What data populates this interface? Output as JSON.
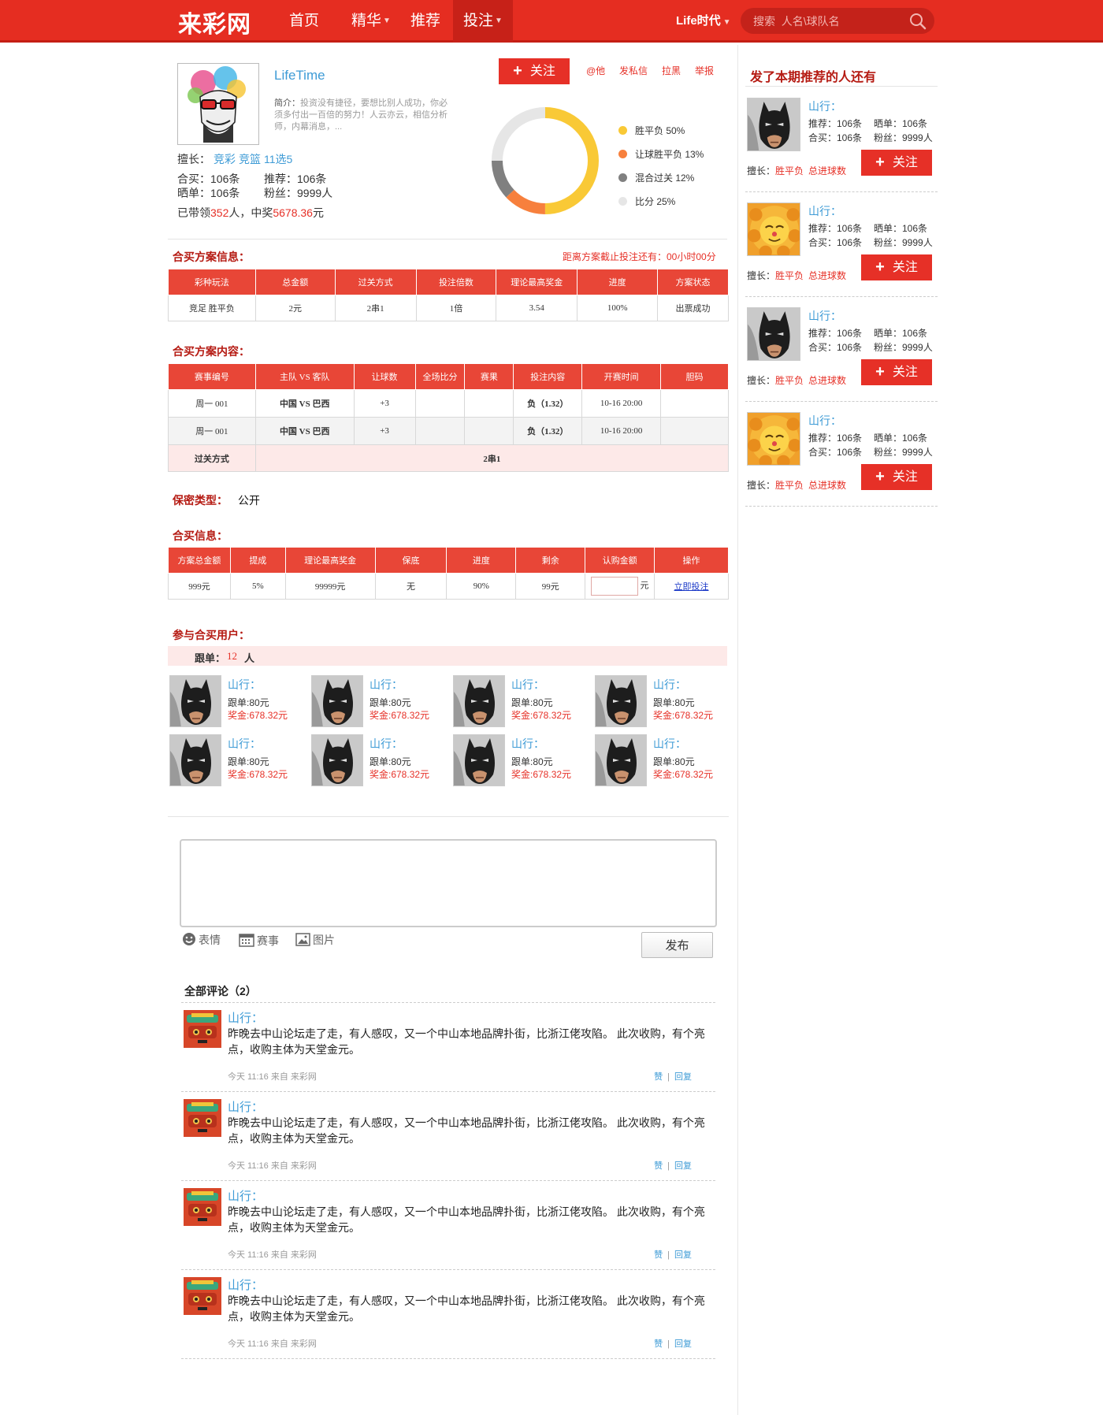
{
  "header": {
    "logo": "来彩网",
    "nav": [
      {
        "label": "首页"
      },
      {
        "label": "精华"
      },
      {
        "label": "推荐"
      },
      {
        "label": "投注"
      }
    ],
    "user": "Life时代",
    "search_placeholder": "搜索  人名\\球队名"
  },
  "profile": {
    "name": "LifeTime",
    "intro_label": "简介：",
    "intro": "投资没有捷径，要想比别人成功，你必须多付出一百倍的努力！人云亦云，相信分析师，内幕消息，...",
    "expertise_label": "擅长：",
    "expertise": [
      "竞彩",
      "竞篮",
      "11选5"
    ],
    "stats": {
      "hemai": "合买：106条",
      "tuijian": "推荐：106条",
      "shaidan": "晒单：106条",
      "fensi": "粉丝：9999人"
    },
    "led_prefix": "已带领",
    "led_count": "352",
    "led_mid": "人，中奖",
    "led_amount": "5678.36",
    "led_suffix": "元",
    "follow": "关注",
    "links": [
      "@他",
      "发私信",
      "拉黑",
      "举报"
    ]
  },
  "chart_data": {
    "type": "pie",
    "categories": [
      "胜平负",
      "让球胜平负",
      "混合过关",
      "比分"
    ],
    "values": [
      50,
      13,
      12,
      25
    ],
    "labels": [
      "胜平负  50%",
      "让球胜平负  13%",
      "混合过关  12%",
      "比分  25%"
    ],
    "colors": [
      "#f9c936",
      "#f7803d",
      "#808080",
      "#e6e6e6"
    ]
  },
  "plan_info": {
    "title": "合买方案信息：",
    "countdown": "距离方案截止投注还有：00小时00分",
    "headers": [
      "彩种玩法",
      "总金额",
      "过关方式",
      "投注倍数",
      "理论最高奖金",
      "进度",
      "方案状态"
    ],
    "row": [
      "竞足 胜平负",
      "2元",
      "2串1",
      "1倍",
      "3.54",
      "100%",
      "出票成功"
    ]
  },
  "plan_content": {
    "title": "合买方案内容：",
    "headers": [
      "赛事编号",
      "主队 VS 客队",
      "让球数",
      "全场比分",
      "赛果",
      "投注内容",
      "开赛时间",
      "胆码"
    ],
    "rows": [
      [
        "周一 001",
        "中国 VS 巴西",
        "+3",
        "",
        "",
        "负（1.32）",
        "10-16 20:00",
        ""
      ],
      [
        "周一 001",
        "中国 VS 巴西",
        "+3",
        "",
        "",
        "负（1.32）",
        "10-16 20:00",
        ""
      ]
    ],
    "pass_label": "过关方式",
    "pass_value": "2串1"
  },
  "secrecy": {
    "label": "保密类型：",
    "value": "公开"
  },
  "buy_info": {
    "title": "合买信息：",
    "headers": [
      "方案总金额",
      "提成",
      "理论最高奖金",
      "保底",
      "进度",
      "剩余",
      "认购金额",
      "操作"
    ],
    "row": [
      "999元",
      "5%",
      "99999元",
      "无",
      "90%",
      "99元"
    ],
    "unit": "元",
    "action": "立即投注"
  },
  "participants": {
    "title": "参与合买用户：",
    "follow_label": "跟单：",
    "follow_count": "12",
    "follow_unit": "人",
    "items": [
      {
        "name": "山行：",
        "follow": "跟单:80元",
        "bonus": "奖金:678.32元"
      },
      {
        "name": "山行：",
        "follow": "跟单:80元",
        "bonus": "奖金:678.32元"
      },
      {
        "name": "山行：",
        "follow": "跟单:80元",
        "bonus": "奖金:678.32元"
      },
      {
        "name": "山行：",
        "follow": "跟单:80元",
        "bonus": "奖金:678.32元"
      },
      {
        "name": "山行：",
        "follow": "跟单:80元",
        "bonus": "奖金:678.32元"
      },
      {
        "name": "山行：",
        "follow": "跟单:80元",
        "bonus": "奖金:678.32元"
      },
      {
        "name": "山行：",
        "follow": "跟单:80元",
        "bonus": "奖金:678.32元"
      },
      {
        "name": "山行：",
        "follow": "跟单:80元",
        "bonus": "奖金:678.32元"
      }
    ]
  },
  "composer": {
    "tools": [
      "表情",
      "赛事",
      "图片"
    ],
    "publish": "发布"
  },
  "comments": {
    "title": "全部评论（2）",
    "items": [
      {
        "name": "山行：",
        "text": "昨晚去中山论坛走了走，有人感叹，又一个中山本地品牌扑街，比浙江佬攻陷。 此次收购，有个亮点，收购主体为天堂金元。",
        "meta": "今天 11:16    来自 来彩网",
        "like": "赞",
        "reply": "回复"
      },
      {
        "name": "山行：",
        "text": "昨晚去中山论坛走了走，有人感叹，又一个中山本地品牌扑街，比浙江佬攻陷。 此次收购，有个亮点，收购主体为天堂金元。",
        "meta": "今天 11:16    来自 来彩网",
        "like": "赞",
        "reply": "回复"
      },
      {
        "name": "山行：",
        "text": "昨晚去中山论坛走了走，有人感叹，又一个中山本地品牌扑街，比浙江佬攻陷。 此次收购，有个亮点，收购主体为天堂金元。",
        "meta": "今天 11:16    来自 来彩网",
        "like": "赞",
        "reply": "回复"
      },
      {
        "name": "山行：",
        "text": "昨晚去中山论坛走了走，有人感叹，又一个中山本地品牌扑街，比浙江佬攻陷。 此次收购，有个亮点，收购主体为天堂金元。",
        "meta": "今天 11:16    来自 来彩网",
        "like": "赞",
        "reply": "回复"
      }
    ]
  },
  "sidebar": {
    "title": "发了本期推荐的人还有",
    "expertise_label": "擅长：",
    "items": [
      {
        "name": "山行：",
        "tuijian": "推荐：106条",
        "shaidan": "晒单：106条",
        "hemai": "合买：106条",
        "fensi": "粉丝：9999人",
        "exp1": "胜平负",
        "exp2": "总进球数",
        "follow": "关注",
        "avatar": "batman"
      },
      {
        "name": "山行：",
        "tuijian": "推荐：106条",
        "shaidan": "晒单：106条",
        "hemai": "合买：106条",
        "fensi": "粉丝：9999人",
        "exp1": "胜平负",
        "exp2": "总进球数",
        "follow": "关注",
        "avatar": "lion"
      },
      {
        "name": "山行：",
        "tuijian": "推荐：106条",
        "shaidan": "晒单：106条",
        "hemai": "合买：106条",
        "fensi": "粉丝：9999人",
        "exp1": "胜平负",
        "exp2": "总进球数",
        "follow": "关注",
        "avatar": "batman"
      },
      {
        "name": "山行：",
        "tuijian": "推荐：106条",
        "shaidan": "晒单：106条",
        "hemai": "合买：106条",
        "fensi": "粉丝：9999人",
        "exp1": "胜平负",
        "exp2": "总进球数",
        "follow": "关注",
        "avatar": "lion"
      }
    ]
  }
}
